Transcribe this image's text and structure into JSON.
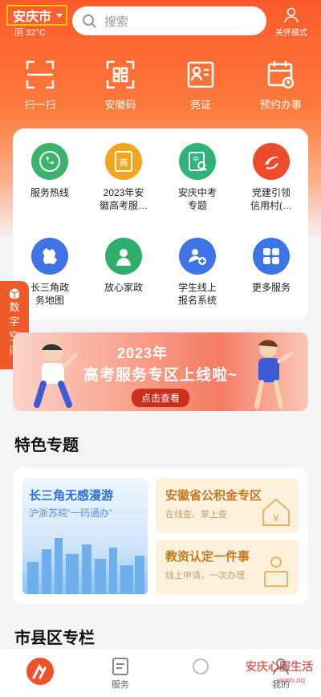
{
  "header": {
    "city": "安庆市",
    "weather": "阴 32°C",
    "search_placeholder": "搜索",
    "care_mode": "关怀模式"
  },
  "quick_actions": [
    {
      "label": "扫一扫",
      "icon": "scan-icon"
    },
    {
      "label": "安徽码",
      "icon": "qrcode-icon"
    },
    {
      "label": "亮证",
      "icon": "id-card-icon"
    },
    {
      "label": "预约办事",
      "icon": "calendar-icon"
    }
  ],
  "services": [
    {
      "label": "服务热线",
      "icon": "phone-icon",
      "color": "#3bb36b"
    },
    {
      "label": "2023年安\n徽高考服…",
      "icon": "exam-icon",
      "color": "#f2a51d"
    },
    {
      "label": "安庆中考\n专题",
      "icon": "middle-exam-icon",
      "color": "#2fb37a"
    },
    {
      "label": "党建引领\n信用村(…",
      "icon": "party-icon",
      "color": "#ee4a2c"
    },
    {
      "label": "长三角政\n务地图",
      "icon": "map-icon",
      "color": "#3e74e6"
    },
    {
      "label": "放心家政",
      "icon": "housekeeping-icon",
      "color": "#2fae6b"
    },
    {
      "label": "学生线上\n报名系统",
      "icon": "student-icon",
      "color": "#3f74e6"
    },
    {
      "label": "更多服务",
      "icon": "more-icon",
      "color": "#3f74e6"
    }
  ],
  "side_tab": {
    "chars": [
      "数",
      "字",
      "空",
      "间"
    ]
  },
  "banner": {
    "line1": "2023年",
    "line2": "高考服务专区上线啦~",
    "button": "点击查看"
  },
  "sections": {
    "featured": "特色专题",
    "city_county": "市县区专栏"
  },
  "featured": {
    "left": {
      "title": "长三角无感漫游",
      "subtitle": "沪浙苏皖“一码通办”"
    },
    "right_top": {
      "title": "安徽省公积金专区",
      "subtitle": "在线查、掌上查"
    },
    "right_bottom": {
      "title": "教资认定一件事",
      "subtitle": "线上申请，一次办理"
    }
  },
  "tabbar": [
    {
      "label": "",
      "icon": "home-logo-icon"
    },
    {
      "label": "服务",
      "icon": "service-icon"
    },
    {
      "label": "",
      "icon": "center-icon"
    },
    {
      "label": "我的",
      "icon": "profile-icon"
    }
  ],
  "watermark": {
    "line1": "安庆心服生活",
    "line2": "www.aq"
  }
}
